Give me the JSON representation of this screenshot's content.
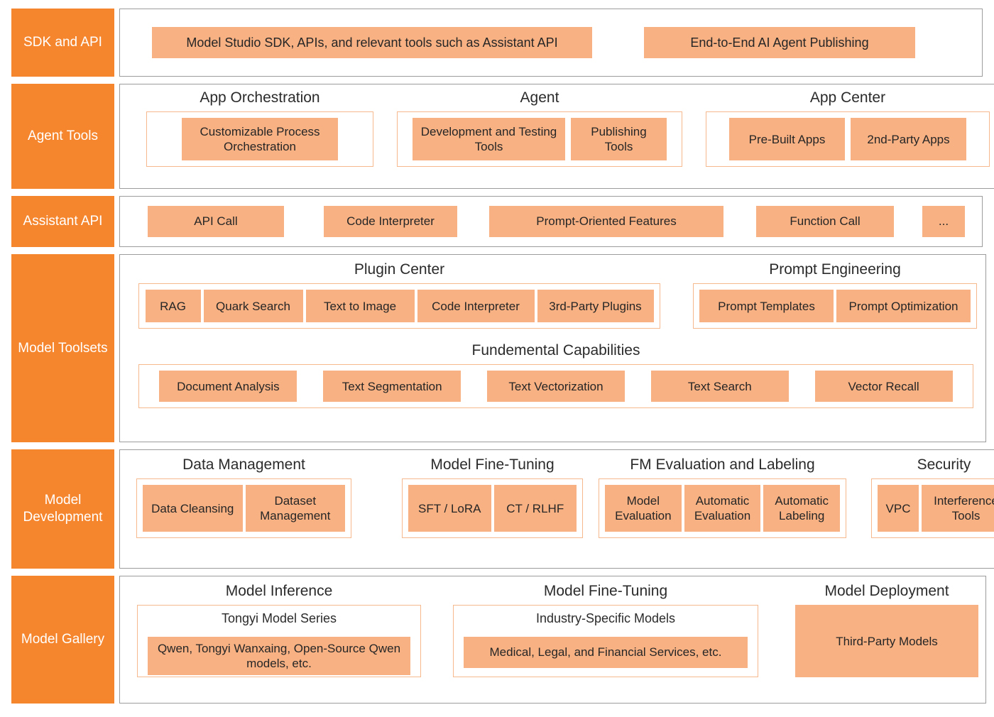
{
  "colors": {
    "sidebar_orange": "#F5862E",
    "chip_fill": "#F8B183",
    "group_border": "#F6B98E",
    "panel_border": "#9c9c9c",
    "text": "#262626"
  },
  "layers": [
    {
      "label": "SDK and API",
      "chips": [
        {
          "label": "Model Studio SDK, APIs, and relevant tools such as Assistant API"
        },
        {
          "label": "End-to-End AI Agent Publishing"
        }
      ]
    },
    {
      "label": "Agent Tools",
      "groups": [
        {
          "title": "App Orchestration",
          "chips": [
            {
              "label": "Customizable Process Orchestration"
            }
          ]
        },
        {
          "title": "Agent",
          "chips": [
            {
              "label": "Development and Testing Tools"
            },
            {
              "label": "Publishing Tools"
            }
          ]
        },
        {
          "title": "App Center",
          "chips": [
            {
              "label": "Pre-Built Apps"
            },
            {
              "label": "2nd-Party Apps"
            }
          ]
        }
      ]
    },
    {
      "label": "Assistant API",
      "chips": [
        {
          "label": "API Call"
        },
        {
          "label": "Code Interpreter"
        },
        {
          "label": "Prompt-Oriented Features"
        },
        {
          "label": "Function Call"
        },
        {
          "label": "..."
        }
      ]
    },
    {
      "label": "Model Toolsets",
      "groups": [
        {
          "title": "Plugin Center",
          "chips": [
            {
              "label": "RAG"
            },
            {
              "label": "Quark Search"
            },
            {
              "label": "Text to Image"
            },
            {
              "label": "Code Interpreter"
            },
            {
              "label": "3rd-Party Plugins"
            }
          ]
        },
        {
          "title": "Prompt Engineering",
          "chips": [
            {
              "label": "Prompt Templates"
            },
            {
              "label": "Prompt Optimization"
            }
          ]
        },
        {
          "title": "Fundemental Capabilities",
          "chips": [
            {
              "label": "Document Analysis"
            },
            {
              "label": "Text Segmentation"
            },
            {
              "label": "Text Vectorization"
            },
            {
              "label": "Text Search"
            },
            {
              "label": "Vector Recall"
            }
          ]
        }
      ]
    },
    {
      "label": "Model Development",
      "groups": [
        {
          "title": "Data Management",
          "chips": [
            {
              "label": "Data Cleansing"
            },
            {
              "label": "Dataset Management"
            }
          ]
        },
        {
          "title": "Model Fine-Tuning",
          "chips": [
            {
              "label": "SFT / LoRA"
            },
            {
              "label": "CT / RLHF"
            }
          ]
        },
        {
          "title": "FM Evaluation and Labeling",
          "chips": [
            {
              "label": "Model Evaluation"
            },
            {
              "label": "Automatic Evaluation"
            },
            {
              "label": "Automatic Labeling"
            }
          ]
        },
        {
          "title": "Security",
          "chips": [
            {
              "label": "VPC"
            },
            {
              "label": "Interference Tools"
            }
          ]
        }
      ]
    },
    {
      "label": "Model Gallery",
      "groups": [
        {
          "title": "Model Inference",
          "subtitle": "Tongyi Model Series",
          "chips": [
            {
              "label": "Qwen, Tongyi Wanxaing, Open-Source Qwen models, etc."
            }
          ]
        },
        {
          "title": "Model Fine-Tuning",
          "subtitle": "Industry-Specific Models",
          "chips": [
            {
              "label": "Medical, Legal, and Financial Services, etc."
            }
          ]
        },
        {
          "title": "Model Deployment",
          "chips": [
            {
              "label": "Third-Party Models"
            }
          ]
        }
      ]
    }
  ]
}
